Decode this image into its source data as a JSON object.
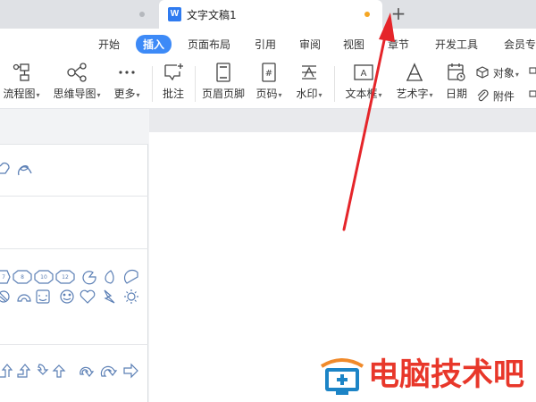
{
  "tabs": {
    "active_title": "文字文稿1",
    "new_tab_symbol": "+"
  },
  "menu": {
    "items": [
      "开始",
      "插入",
      "页面布局",
      "引用",
      "审阅",
      "视图",
      "章节",
      "开发工具",
      "会员专"
    ],
    "active": "插入"
  },
  "ribbon": {
    "flowchart": "流程图",
    "mindmap": "思维导图",
    "more": "更多",
    "comment": "批注",
    "header_footer": "页眉页脚",
    "page_number": "页码",
    "watermark": "水印",
    "textbox": "文本框",
    "wordart": "艺术字",
    "date": "日期",
    "object": "对象",
    "attachment": "附件"
  },
  "watermark_logo": {
    "text": "电脑技术吧"
  },
  "colors": {
    "accent": "#3d8af7",
    "annotation_arrow": "#e5252a",
    "logo_red": "#e8372a",
    "unsaved_dot": "#f5a623"
  }
}
